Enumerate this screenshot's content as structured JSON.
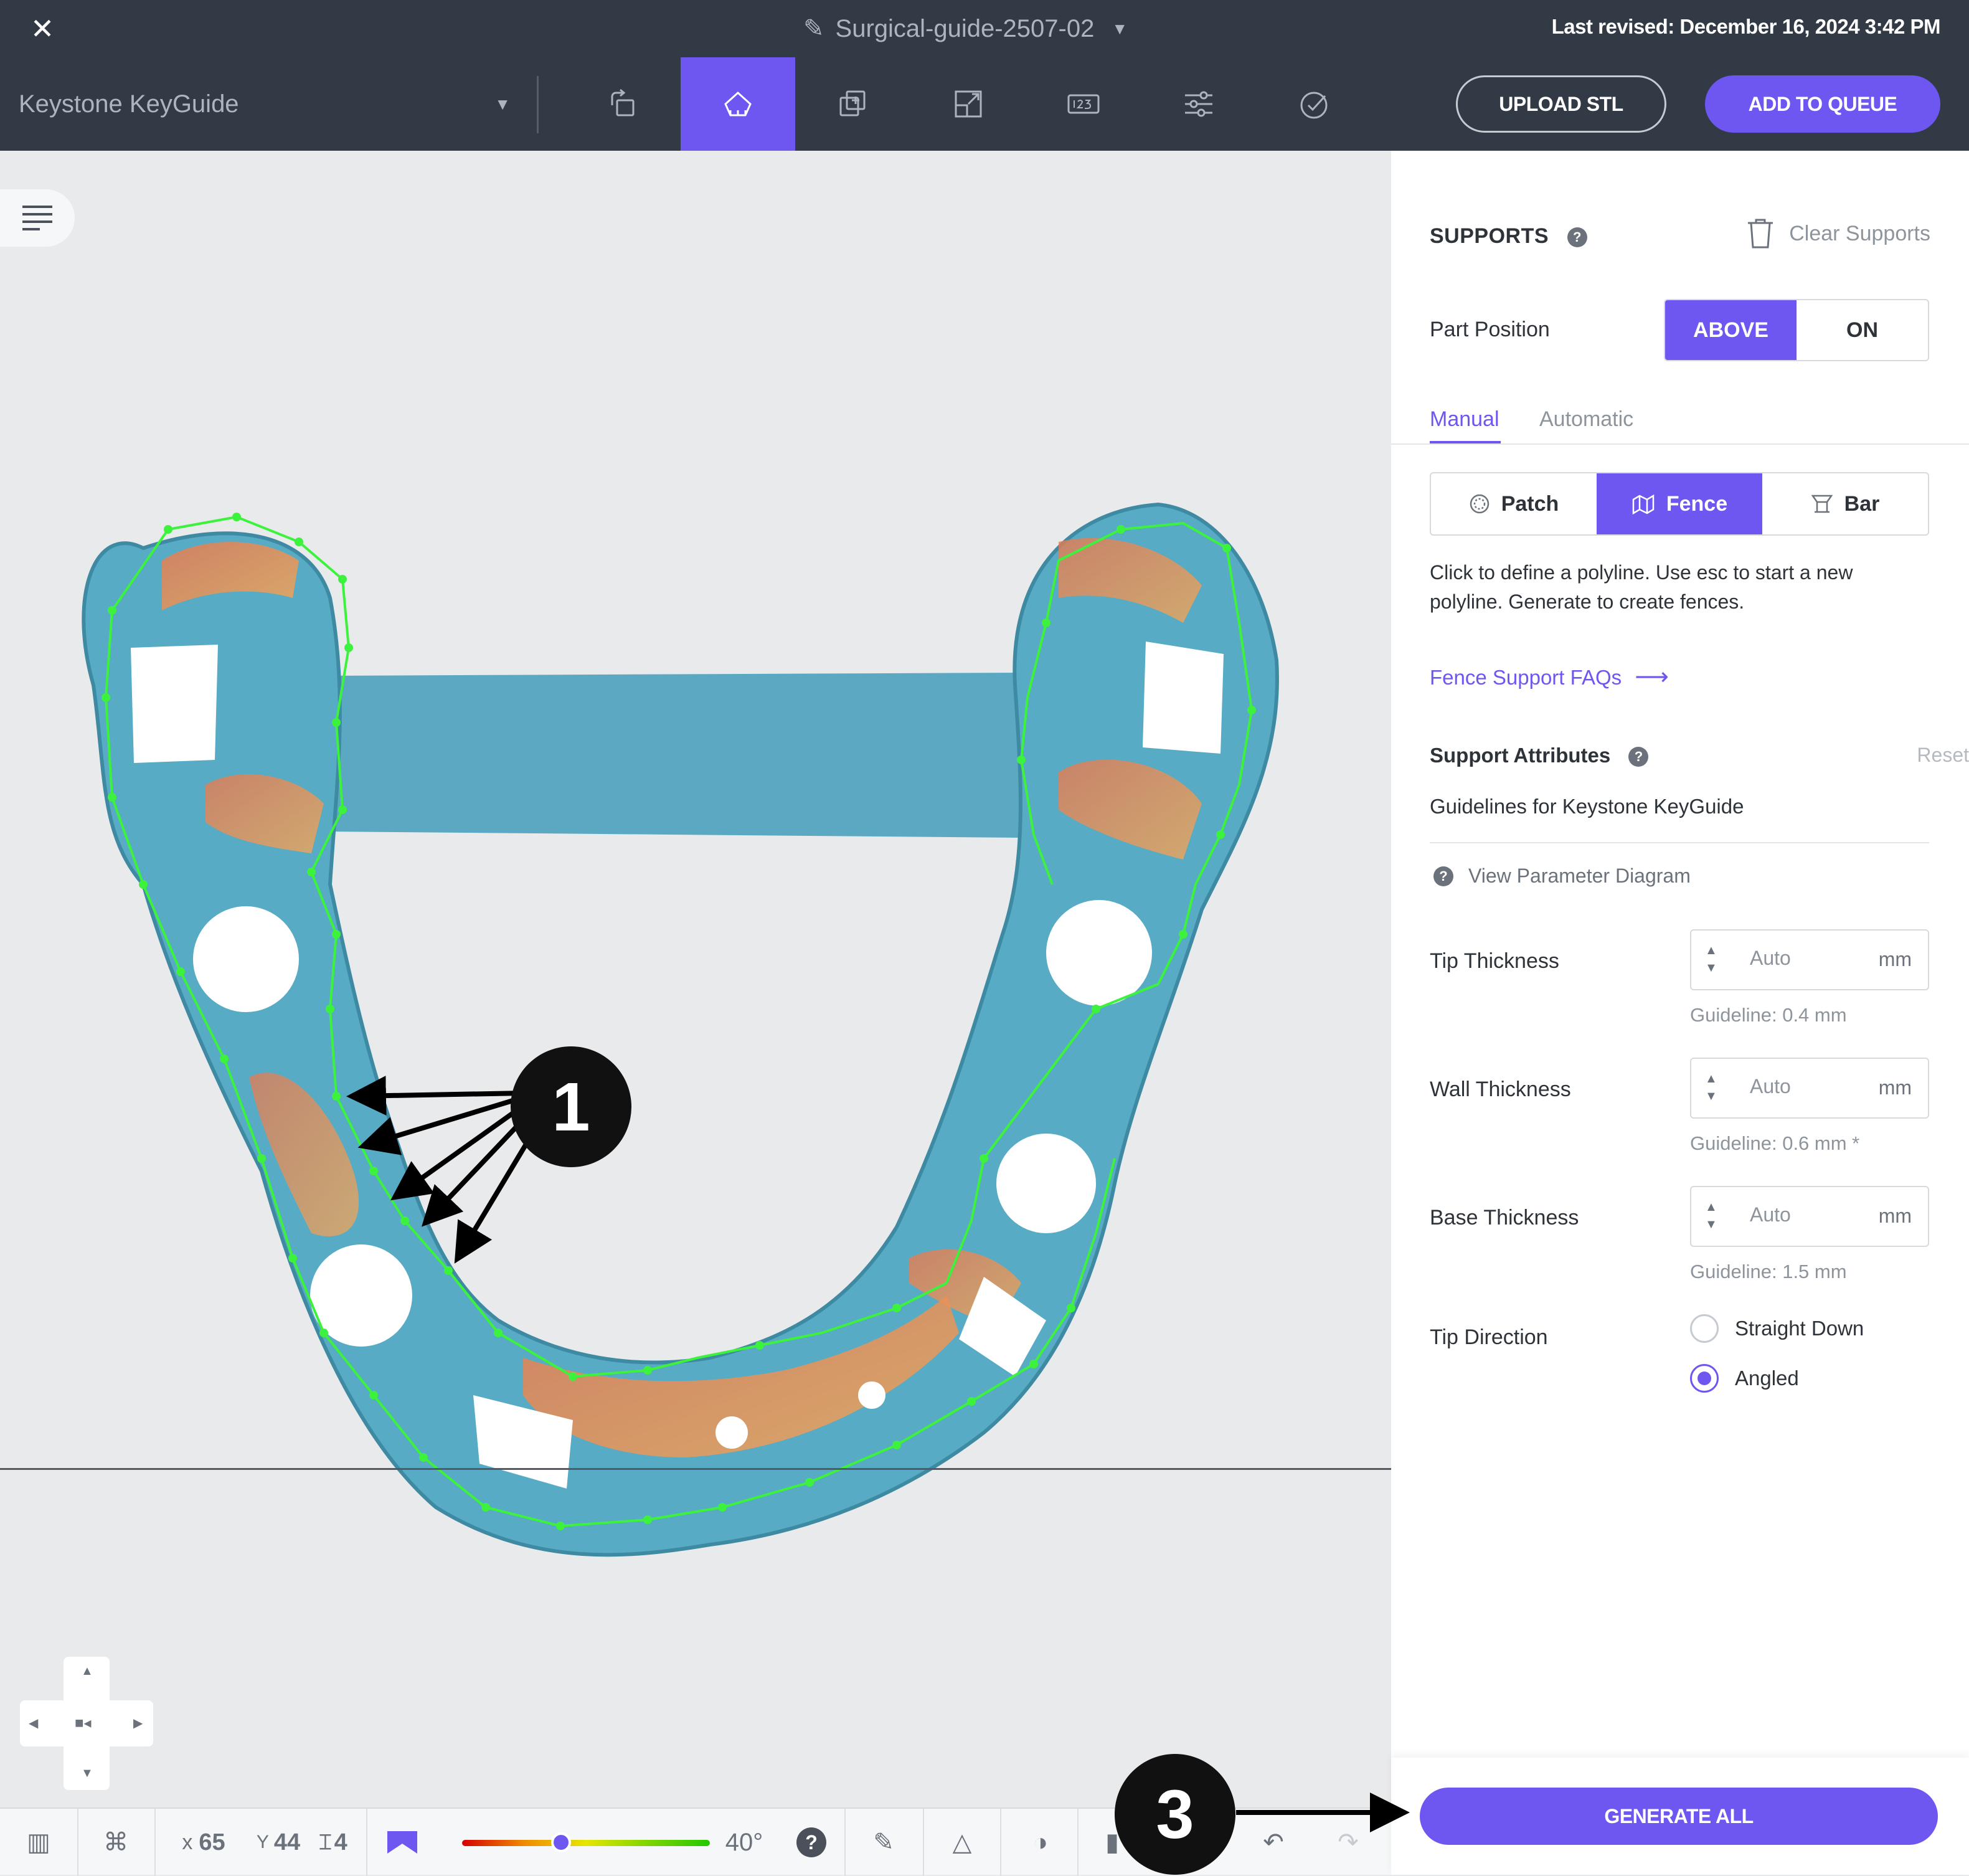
{
  "header": {
    "file_name": "Surgical-guide-2507-02",
    "last_revised": "Last revised: December 16, 2024 3:42 PM"
  },
  "toolbar": {
    "printer": "Keystone KeyGuide",
    "upload_label": "UPLOAD STL",
    "queue_label": "ADD TO QUEUE",
    "tools": [
      "orient-icon",
      "supports-icon",
      "duplicate-icon",
      "scale-icon",
      "label-icon",
      "settings-icon",
      "check-icon"
    ],
    "active_tool": "supports-icon"
  },
  "panel": {
    "title": "SUPPORTS",
    "clear_label": "Clear Supports",
    "part_position_label": "Part Position",
    "part_position_options": [
      "ABOVE",
      "ON"
    ],
    "part_position_selected": "ABOVE",
    "tabs": [
      "Manual",
      "Automatic"
    ],
    "active_tab": "Manual",
    "support_types": [
      "Patch",
      "Fence",
      "Bar"
    ],
    "active_type": "Fence",
    "description": "Click to define a polyline. Use esc to start a new polyline. Generate to create fences.",
    "faq_link": "Fence Support FAQs",
    "attributes_label": "Support Attributes",
    "reset_label": "Reset",
    "guidelines_label": "Guidelines for Keystone KeyGuide",
    "view_diagram_label": "View Parameter Diagram",
    "tip_thickness": {
      "label": "Tip Thickness",
      "value": "Auto",
      "unit": "mm",
      "guideline": "Guideline: 0.4 mm"
    },
    "wall_thickness": {
      "label": "Wall Thickness",
      "value": "Auto",
      "unit": "mm",
      "guideline": "Guideline: 0.6 mm *"
    },
    "base_thickness": {
      "label": "Base Thickness",
      "value": "Auto",
      "unit": "mm",
      "guideline": "Guideline: 1.5 mm"
    },
    "tip_direction": {
      "label": "Tip Direction",
      "options": [
        "Straight Down",
        "Angled"
      ],
      "selected": "Angled"
    },
    "generate_label": "GENERATE ALL"
  },
  "status": {
    "x_label": "x",
    "x_value": "65",
    "y_label": "Y",
    "y_value": "44",
    "z_value": "4",
    "angle": "40°",
    "slider_fraction": 0.4
  },
  "callouts": [
    "1",
    "3"
  ],
  "colors": {
    "accent": "#6d57f0",
    "topbar": "#323a46",
    "model_blue": "#58abc4",
    "fence_green": "#3df23d"
  }
}
